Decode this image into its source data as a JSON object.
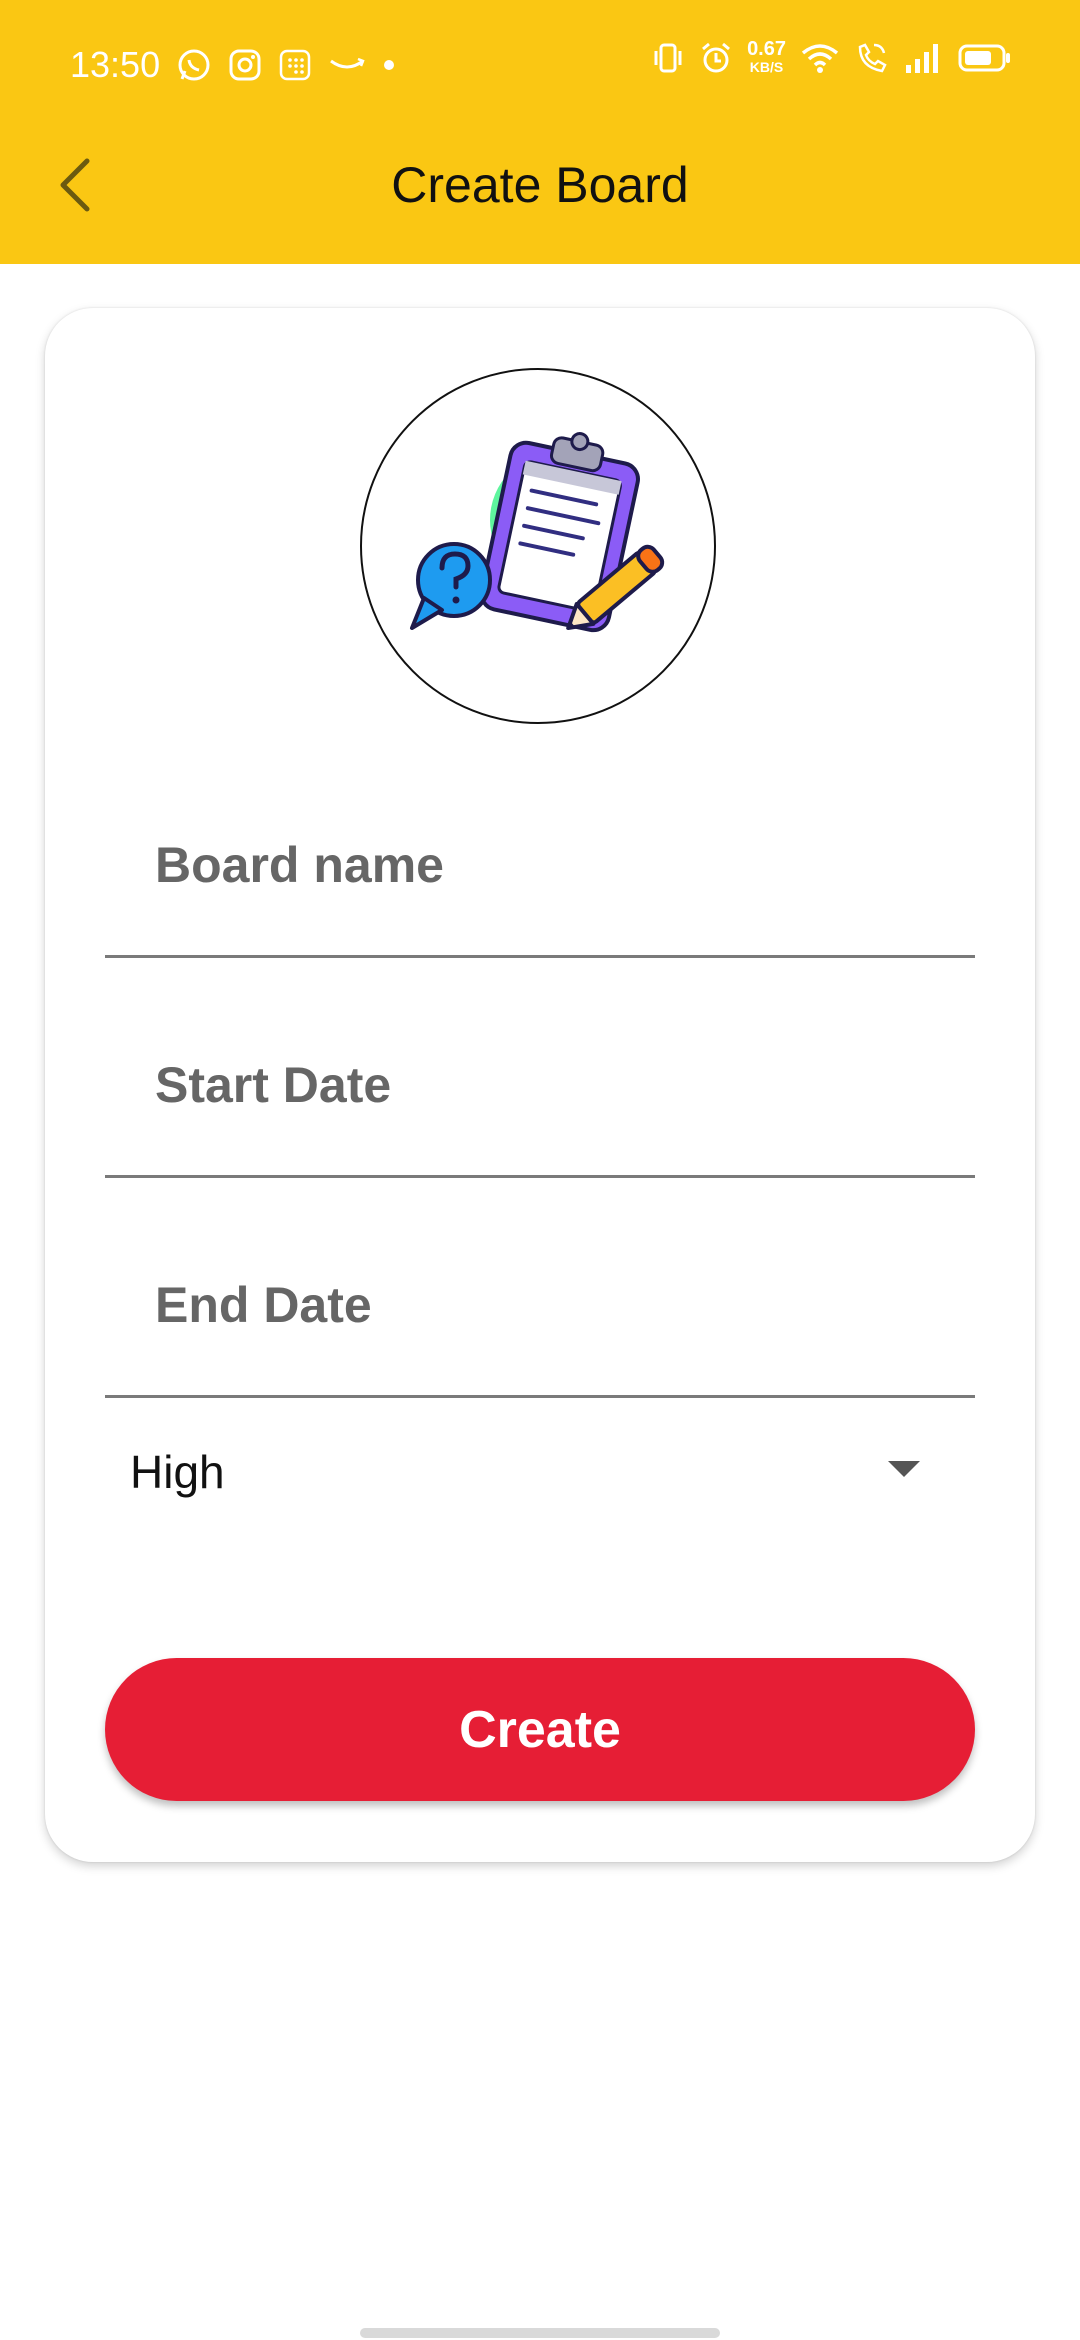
{
  "status_bar": {
    "time": "13:50",
    "net_speed_value": "0.67",
    "net_speed_unit": "KB/S",
    "icons_left": [
      "whatsapp-icon",
      "instagram-icon",
      "sim-toolkit-icon",
      "amazon-icon",
      "dot-icon"
    ],
    "icons_right": [
      "vibrate-icon",
      "alarm-icon",
      "wifi-icon",
      "wifi-calling-icon",
      "signal-icon",
      "battery-icon"
    ]
  },
  "app_bar": {
    "title": "Create Board",
    "back_icon": "chevron-left-icon",
    "background": "#FAC713"
  },
  "form": {
    "board_name_placeholder": "Board name",
    "board_name_value": "",
    "start_date_placeholder": "Start Date",
    "start_date_value": "",
    "end_date_placeholder": "End Date",
    "end_date_value": "",
    "priority_selected": "High",
    "create_label": "Create",
    "create_color": "#E61E35"
  }
}
